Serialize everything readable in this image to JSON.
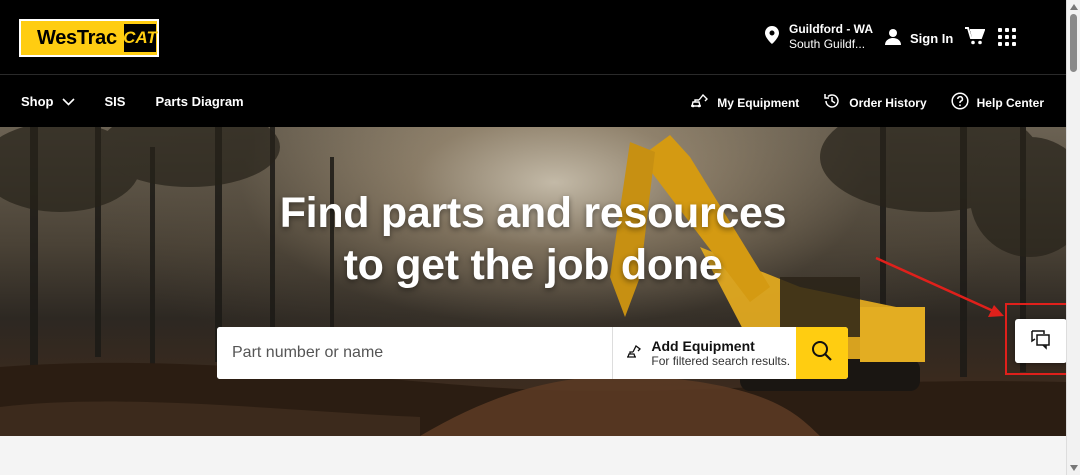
{
  "brand": {
    "name": "WesTrac",
    "sub": "CAT"
  },
  "location": {
    "line1": "Guildford - WA",
    "line2": "South Guildf..."
  },
  "header": {
    "signin_label": "Sign In"
  },
  "nav": {
    "left": [
      {
        "label": "Shop"
      },
      {
        "label": "SIS"
      },
      {
        "label": "Parts Diagram"
      }
    ],
    "right": [
      {
        "label": "My Equipment"
      },
      {
        "label": "Order History"
      },
      {
        "label": "Help Center"
      }
    ]
  },
  "hero": {
    "headline_1": "Find parts and resources",
    "headline_2": "to get the job done"
  },
  "search": {
    "placeholder": "Part number or name",
    "add_equipment_title": "Add Equipment",
    "add_equipment_sub": "For filtered search results."
  },
  "colors": {
    "accent": "#FFCD11",
    "annotation": "#e0201b"
  },
  "icons": [
    "location-pin-icon",
    "user-icon",
    "cart-icon",
    "apps-grid-icon",
    "chevron-down-icon",
    "excavator-icon",
    "history-icon",
    "help-icon",
    "search-icon",
    "chat-icon"
  ]
}
